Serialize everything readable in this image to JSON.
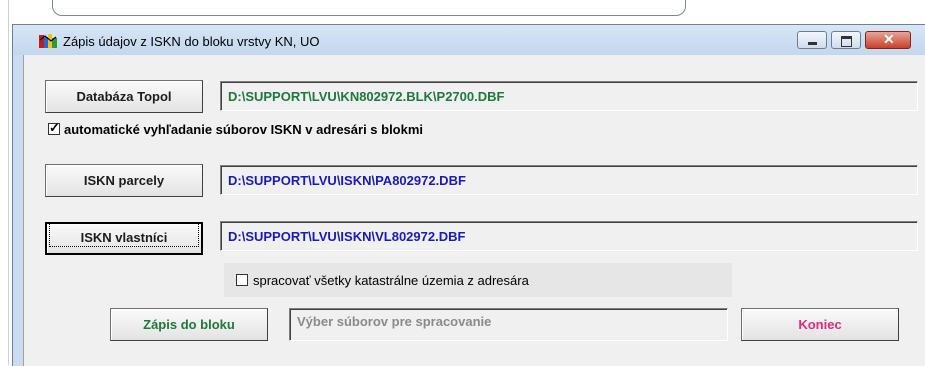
{
  "window": {
    "title": "Zápis údajov z ISKN  do bloku vrstvy KN, UO",
    "caption": {
      "close": "✕"
    }
  },
  "buttons": {
    "database_topol": "Databáza Topol",
    "iskn_parcely": "ISKN parcely",
    "iskn_vlastnici": "ISKN vlastníci",
    "zapis_do_bloku": "Zápis do bloku",
    "koniec": "Koniec"
  },
  "paths": {
    "database_topol": "D:\\SUPPORT\\LVU\\KN802972.BLK\\P2700.DBF",
    "iskn_parcely": "D:\\SUPPORT\\LVU\\ISKN\\PA802972.DBF",
    "iskn_vlastnici": "D:\\SUPPORT\\LVU\\ISKN\\VL802972.DBF",
    "status": "Výber súborov pre spracovanie"
  },
  "options": {
    "auto_search": {
      "label": "automatické vyhľadanie súborov ISKN v adresári  s blokmi",
      "checked": true
    },
    "process_all": {
      "label": "spracovať všetky katastrálne územia z adresára",
      "checked": false
    }
  },
  "colors": {
    "green_text": "#1e7a3a",
    "blue_text": "#1a1ac4",
    "pink_text": "#e8287a",
    "client_bg": "#f0f0f0",
    "titlebar_bg": "#c9dcf1"
  }
}
